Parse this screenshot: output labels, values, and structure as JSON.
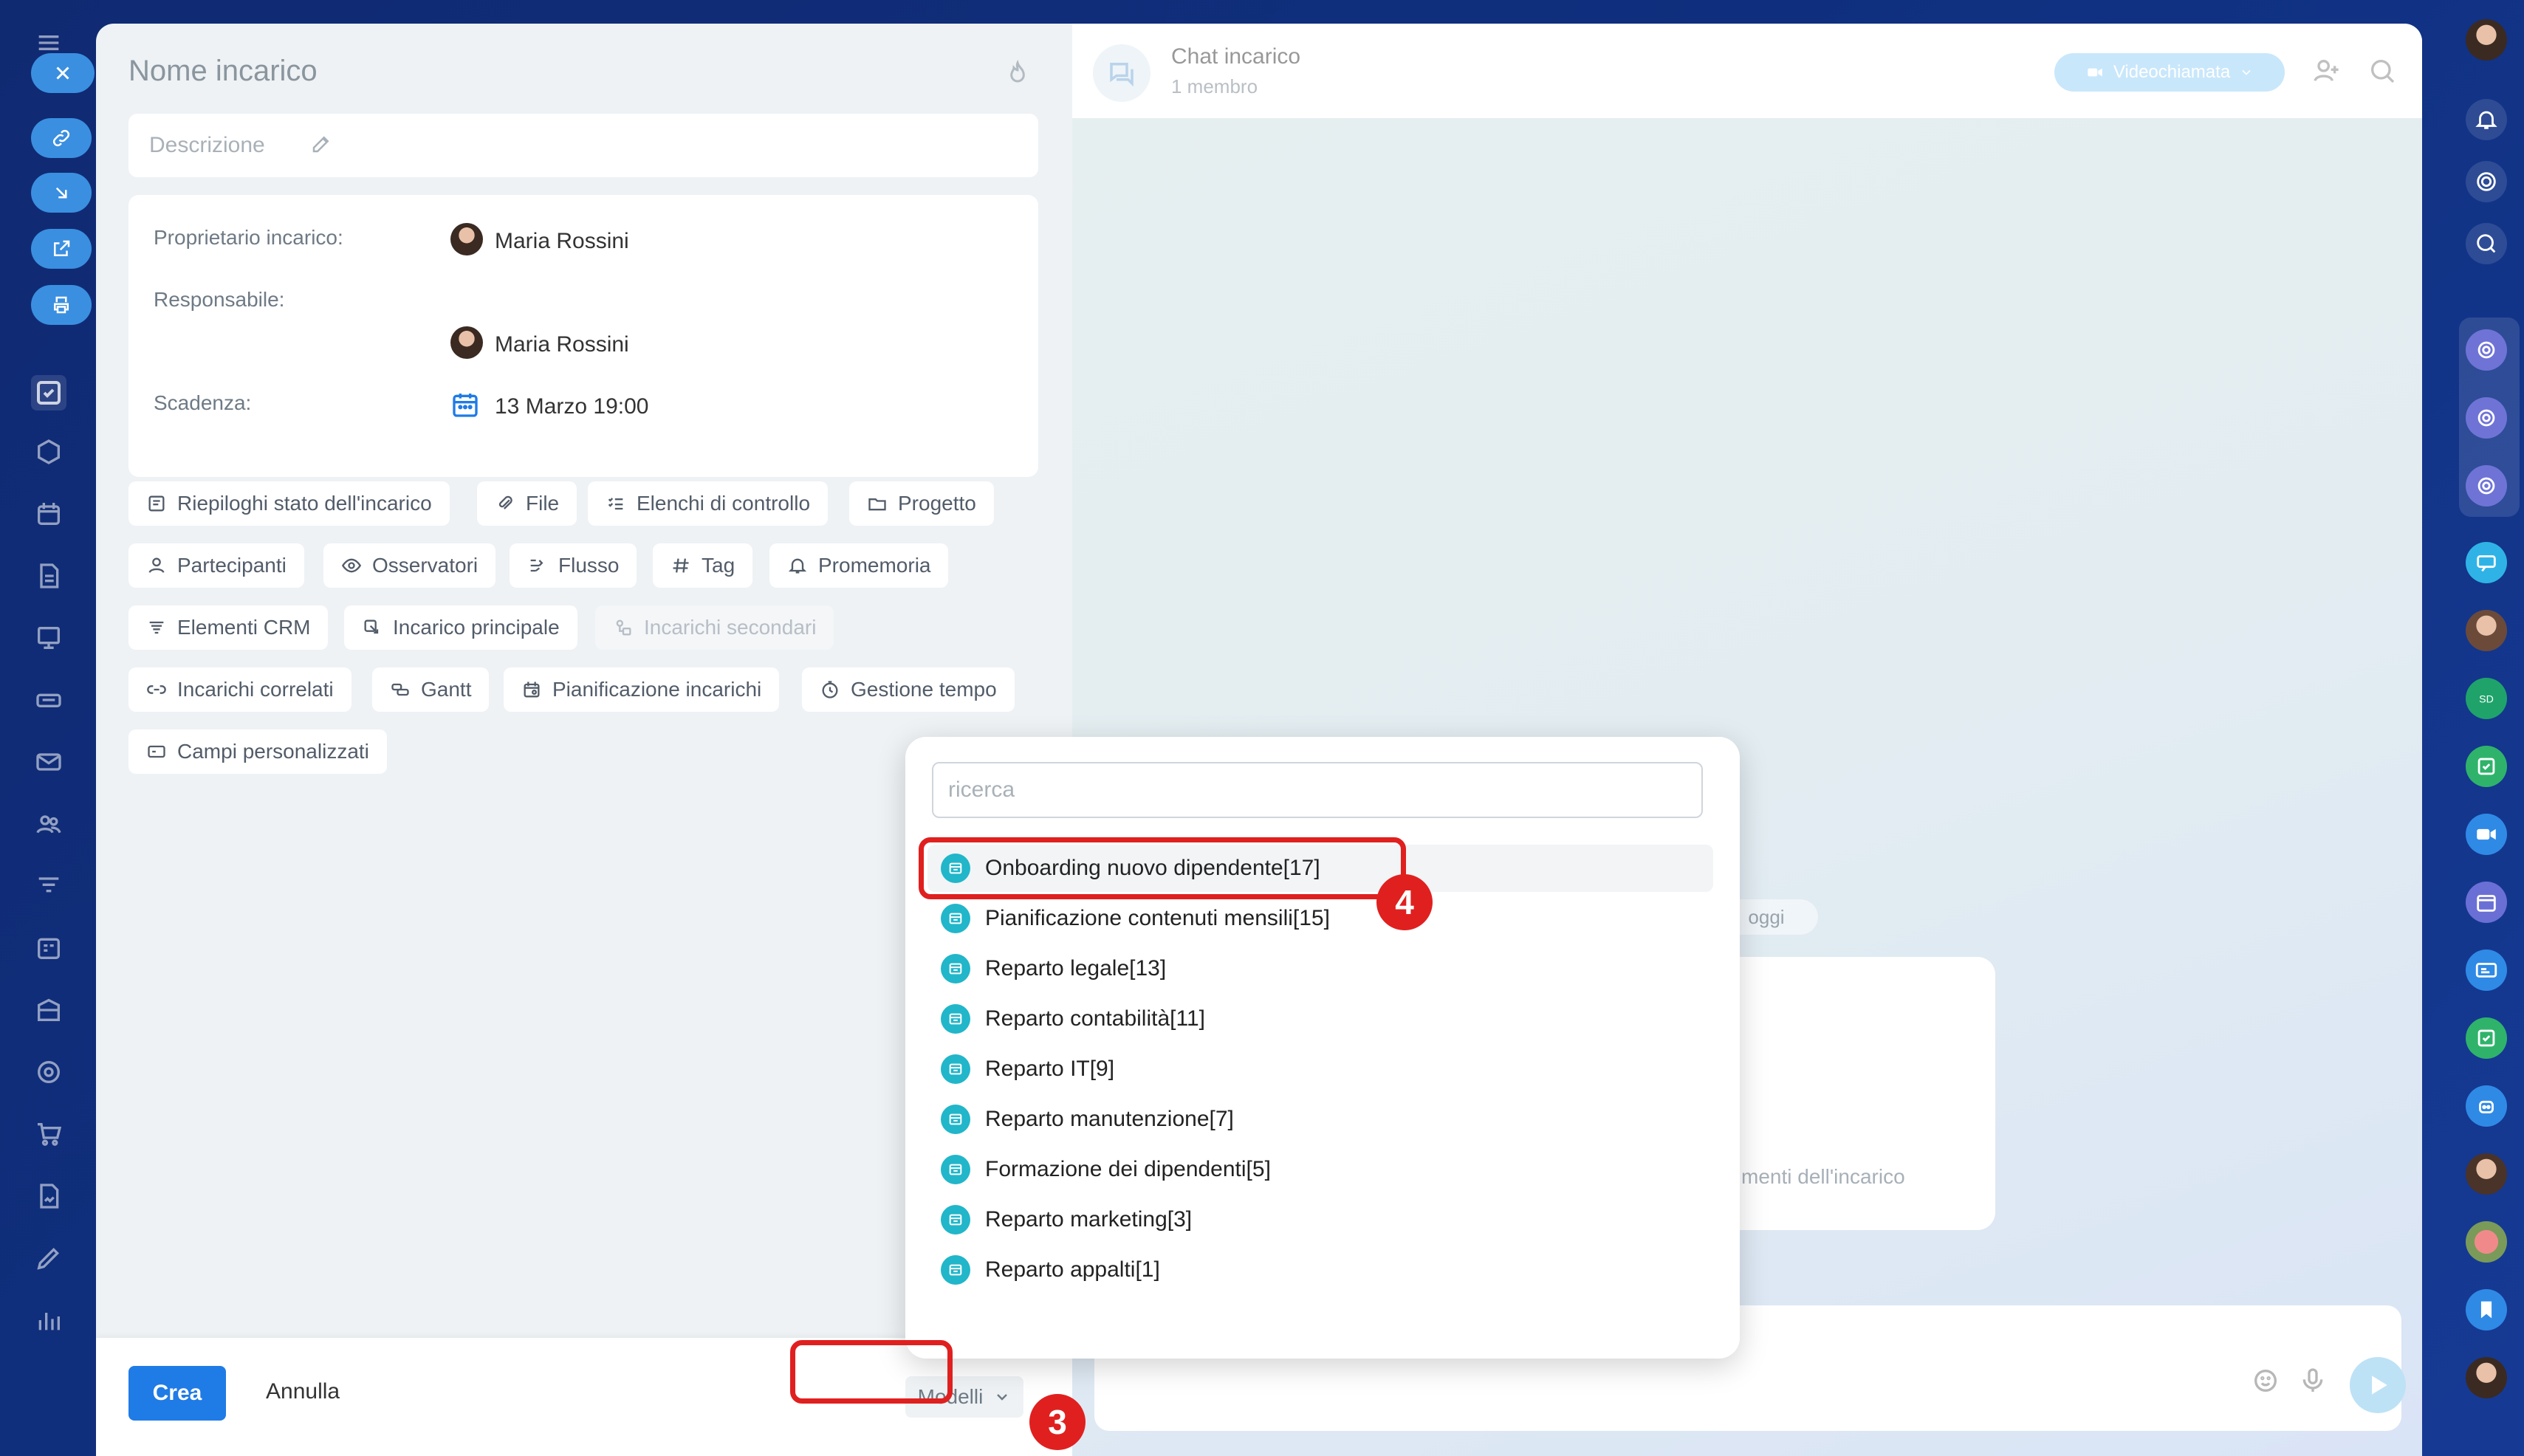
{
  "task": {
    "title_placeholder": "Nome incarico",
    "description_placeholder": "Descrizione",
    "owner_label": "Proprietario incarico:",
    "owner_name": "Maria Rossini",
    "assignee_label": "Responsabile:",
    "assignee_name": "Maria Rossini",
    "deadline_label": "Scadenza:",
    "deadline_value": "13 Marzo 19:00",
    "chips": [
      {
        "label": "Riepiloghi stato dell'incarico",
        "icon": "summary-icon"
      },
      {
        "label": "File",
        "icon": "paperclip-icon"
      },
      {
        "label": "Elenchi di controllo",
        "icon": "checklist-icon"
      },
      {
        "label": "Progetto",
        "icon": "folder-icon"
      },
      {
        "label": "Partecipanti",
        "icon": "person-icon"
      },
      {
        "label": "Osservatori",
        "icon": "eye-icon"
      },
      {
        "label": "Flusso",
        "icon": "flow-icon"
      },
      {
        "label": "Tag",
        "icon": "hash-icon"
      },
      {
        "label": "Promemoria",
        "icon": "bell-icon"
      },
      {
        "label": "Elementi CRM",
        "icon": "crm-icon"
      },
      {
        "label": "Incarico principale",
        "icon": "parent-task-icon"
      },
      {
        "label": "Incarichi secondari",
        "icon": "subtask-icon"
      },
      {
        "label": "Incarichi correlati",
        "icon": "link-icon"
      },
      {
        "label": "Gantt",
        "icon": "gantt-icon"
      },
      {
        "label": "Pianificazione incarichi",
        "icon": "calendar-plan-icon"
      },
      {
        "label": "Gestione tempo",
        "icon": "clock-icon"
      },
      {
        "label": "Campi personalizzati",
        "icon": "custom-fields-icon"
      }
    ],
    "create_button": "Crea",
    "cancel_button": "Annulla",
    "templates_button": "Modelli"
  },
  "chat": {
    "title": "Chat incarico",
    "subtitle": "1 membro",
    "video_button": "Videochiamata",
    "date_chip": "oggi",
    "card_text": "menti dell'incarico"
  },
  "templates_dropdown": {
    "search_placeholder": "ricerca",
    "items": [
      "Onboarding nuovo dipendente[17]",
      "Pianificazione contenuti mensili[15]",
      "Reparto legale[13]",
      "Reparto contabilità[11]",
      "Reparto IT[9]",
      "Reparto manutenzione[7]",
      "Formazione dei dipendenti[5]",
      "Reparto marketing[3]",
      "Reparto appalti[1]"
    ]
  },
  "annotations": {
    "step_templates": "3",
    "step_item": "4"
  },
  "colors": {
    "accent": "#1f7be6",
    "highlight": "#e0201f",
    "template_icon": "#21b6c9"
  }
}
